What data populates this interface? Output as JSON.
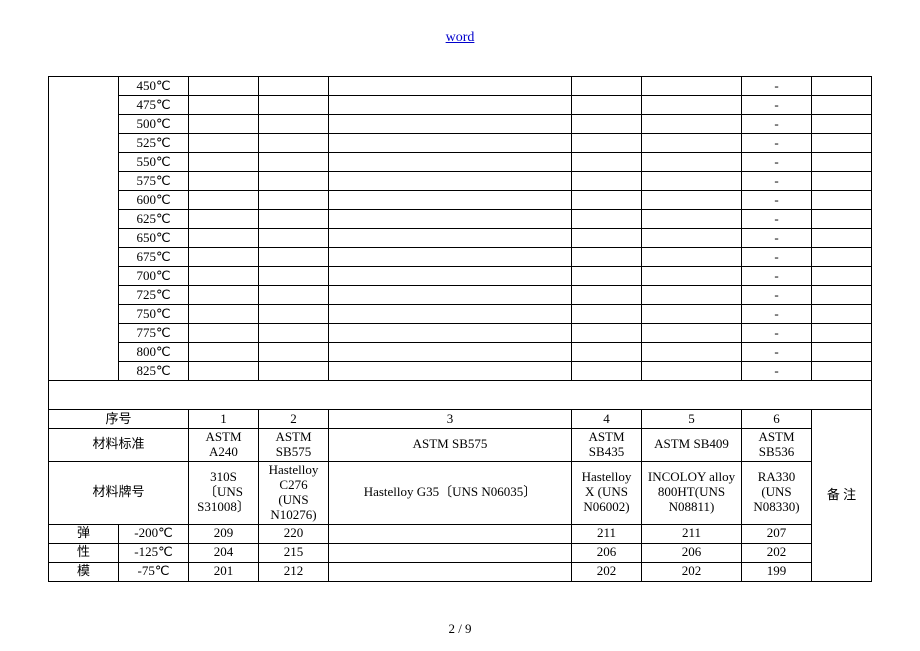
{
  "header": {
    "link_text": "word"
  },
  "footer": {
    "page_text": "2 / 9"
  },
  "upper": {
    "temps": [
      "450℃",
      "475℃",
      "500℃",
      "525℃",
      "550℃",
      "575℃",
      "600℃",
      "625℃",
      "650℃",
      "675℃",
      "700℃",
      "725℃",
      "750℃",
      "775℃",
      "800℃",
      "825℃"
    ],
    "dash": "-"
  },
  "lower": {
    "row_seq": {
      "label": "序号",
      "cells": [
        "1",
        "2",
        "3",
        "4",
        "5",
        "6"
      ],
      "note": "备 注"
    },
    "row_std": {
      "label": "材料标准",
      "cells": [
        "ASTM A240",
        "ASTM SB575",
        "ASTM SB575",
        "ASTM SB435",
        "ASTM SB409",
        "ASTM SB536"
      ]
    },
    "row_grade": {
      "label": "材料牌号",
      "cells": [
        "310S〔UNS S31008〕",
        "Hastelloy C276 (UNS N10276)",
        "Hastelloy G35〔UNS N06035〕",
        "Hastelloy X (UNS N06002)",
        "INCOLOY alloy 800HT(UNS N08811)",
        "RA330 (UNS N08330)"
      ]
    },
    "group_label_chars": [
      "弹",
      "性",
      "模"
    ],
    "data_rows": [
      {
        "temp": "-200℃",
        "cells": [
          "209",
          "220",
          "",
          "211",
          "211",
          "207"
        ]
      },
      {
        "temp": "-125℃",
        "cells": [
          "204",
          "215",
          "",
          "206",
          "206",
          "202"
        ]
      },
      {
        "temp": "-75℃",
        "cells": [
          "201",
          "212",
          "",
          "202",
          "202",
          "199"
        ]
      }
    ]
  }
}
